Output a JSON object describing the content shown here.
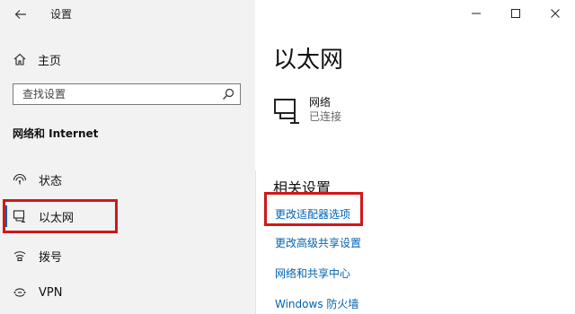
{
  "window": {
    "title": "设置"
  },
  "sidebar": {
    "home_label": "主页",
    "search_placeholder": "查找设置",
    "section_title": "网络和 Internet",
    "items": [
      {
        "label": "状态"
      },
      {
        "label": "以太网"
      },
      {
        "label": "拨号"
      },
      {
        "label": "VPN"
      }
    ]
  },
  "content": {
    "page_title": "以太网",
    "network": {
      "name": "网络",
      "status": "已连接"
    },
    "related_title": "相关设置",
    "links": [
      {
        "label": "更改适配器选项"
      },
      {
        "label": "更改高级共享设置"
      },
      {
        "label": "网络和共享中心"
      },
      {
        "label": "Windows 防火墙"
      }
    ]
  },
  "colors": {
    "accent": "#0063b1",
    "highlight": "#d01818",
    "sidebar_bg": "#f2f2f2"
  }
}
